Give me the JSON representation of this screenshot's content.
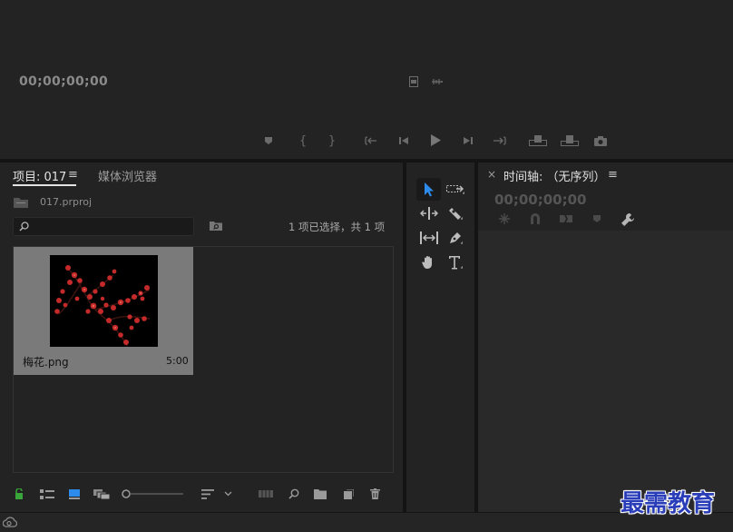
{
  "monitor": {
    "timecode": "00;00;00;00"
  },
  "project": {
    "tab_label": "项目: 017",
    "tab_menu_glyph": "≡",
    "media_tab_label": "媒体浏览器",
    "file_name": "017.prproj",
    "search": {
      "value": "",
      "placeholder": ""
    },
    "selection_status": "1 项已选择，共 1 项",
    "clip": {
      "name": "梅花.png",
      "duration": "5:00"
    }
  },
  "timeline": {
    "close_glyph": "×",
    "title": "时间轴: （无序列）",
    "menu_glyph": "≡",
    "timecode": "00;00;00;00"
  },
  "watermark": "最需教育",
  "colors": {
    "accent_blue": "#2d8ceb",
    "lock_green": "#3aa53a",
    "panel_bg": "#232323"
  }
}
